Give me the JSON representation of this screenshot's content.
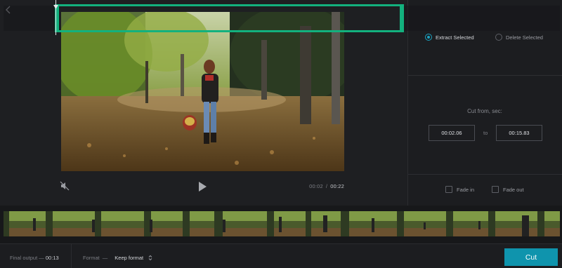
{
  "header": {
    "back_icon": "chevron-left-icon"
  },
  "player": {
    "current_time": "00:02",
    "separator": "/",
    "total_time": "00:22",
    "mute_icon": "speaker-muted-icon",
    "play_icon": "play-icon"
  },
  "mode": {
    "options": [
      {
        "label": "Extract Selected",
        "checked": true
      },
      {
        "label": "Delete Selected",
        "checked": false
      }
    ]
  },
  "cut": {
    "label": "Cut from, sec:",
    "from": "00:02.06",
    "to_label": "to",
    "to": "00:15.83"
  },
  "fade": {
    "fade_in_label": "Fade in",
    "fade_out_label": "Fade out",
    "fade_in_checked": false,
    "fade_out_checked": false
  },
  "footer": {
    "final_output_label": "Final output",
    "final_output_sep": "—",
    "final_output_value": "00:13",
    "format_label": "Format",
    "format_sep": "—",
    "format_value": "Keep format",
    "cut_button": "Cut"
  },
  "colors": {
    "accent": "#1aa3c2",
    "selection": "#13b17e",
    "cut_button": "#0f94ad"
  },
  "timeline": {
    "selection_start_sec": 2.06,
    "selection_end_sec": 15.83,
    "duration_sec": 22
  }
}
